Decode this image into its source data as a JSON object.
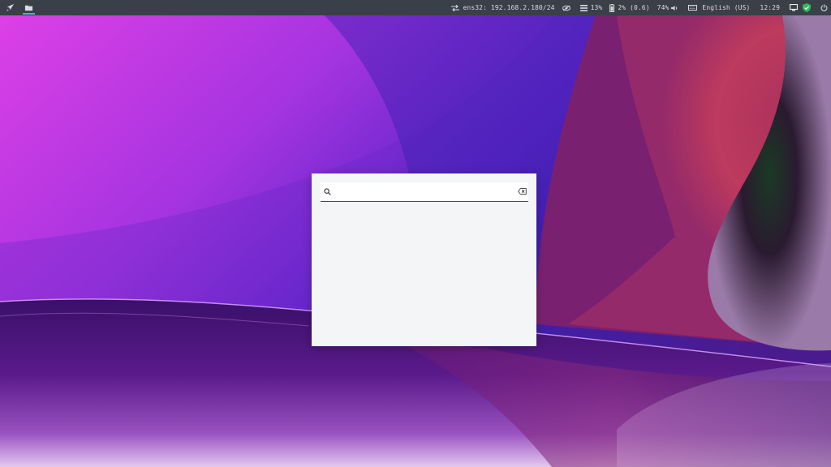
{
  "taskbar": {
    "launcher_icon": "rocket-icon",
    "files_icon": "folder-icon",
    "network": {
      "icon": "network-arrows-icon",
      "text": "ens32: 192.168.2.180/24"
    },
    "visibility_icon": "eye-icon",
    "memory": {
      "icon": "memory-stack-icon",
      "text": "13%"
    },
    "cpu": {
      "icon": "battery-icon",
      "text": "2% (0.6)"
    },
    "volume": {
      "text": "74%",
      "icon": "speaker-icon"
    },
    "keyboard": {
      "icon": "keyboard-icon",
      "text": "English (US)"
    },
    "clock": "12:29",
    "display_icon": "monitor-icon",
    "shield_icon": "shield-check-icon",
    "power_icon": "power-icon"
  },
  "launcher": {
    "search_icon": "search-icon",
    "search_value": "",
    "search_placeholder": "",
    "clear_icon": "backspace-icon"
  },
  "colors": {
    "taskbar_bg": "#3a4048",
    "taskbar_text": "#d8dbe0",
    "active_indicator": "#5ea0e8",
    "shield_green": "#2fb85c",
    "launcher_bg": "#f4f5f7"
  }
}
